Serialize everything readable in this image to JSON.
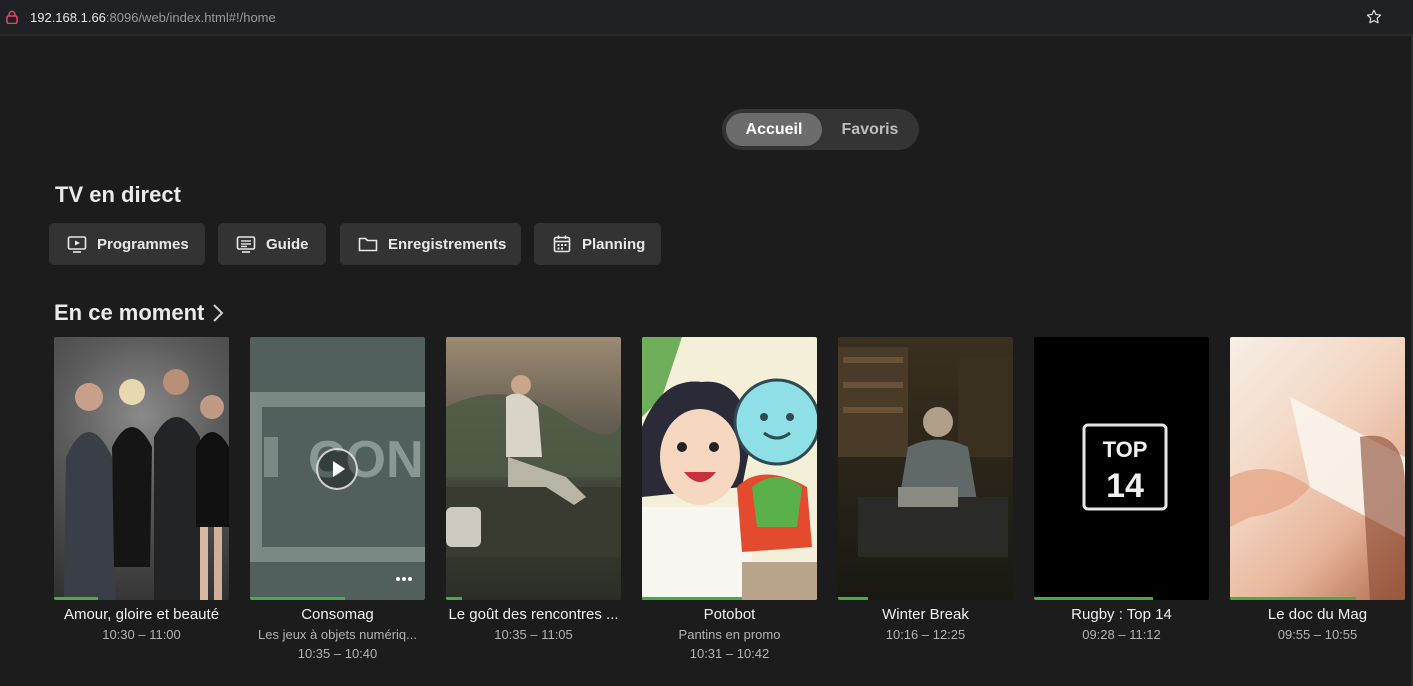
{
  "browser": {
    "url_host": "192.168.1.66",
    "url_path": ":8096/web/index.html#!/home"
  },
  "tabs": [
    {
      "label": "Accueil",
      "active": true
    },
    {
      "label": "Favoris",
      "active": false
    }
  ],
  "live_tv": {
    "title": "TV en direct",
    "buttons": [
      {
        "label": "Programmes",
        "icon": "tv-play-icon"
      },
      {
        "label": "Guide",
        "icon": "guide-icon"
      },
      {
        "label": "Enregistrements",
        "icon": "folder-icon"
      },
      {
        "label": "Planning",
        "icon": "calendar-icon"
      }
    ]
  },
  "now": {
    "title": "En ce moment",
    "items": [
      {
        "title": "Amour, gloire et beauté",
        "subtitle": "",
        "time": "10:30 – 11:00",
        "progress": 0.25
      },
      {
        "title": "Consomag",
        "subtitle": "Les jeux à objets numériq...",
        "time": "10:35 – 10:40",
        "progress": 0.54,
        "thumb_text": "CONSO MAG."
      },
      {
        "title": "Le goût des rencontres ...",
        "subtitle": "",
        "time": "10:35 – 11:05",
        "progress": 0.09
      },
      {
        "title": "Potobot",
        "subtitle": "Pantins en promo",
        "time": "10:31 – 10:42",
        "progress": 0.57
      },
      {
        "title": "Winter Break",
        "subtitle": "",
        "time": "10:16 – 12:25",
        "progress": 0.17
      },
      {
        "title": "Rugby : Top 14",
        "subtitle": "",
        "time": "09:28 – 11:12",
        "progress": 0.68,
        "thumb_text": "TOP 14"
      },
      {
        "title": "Le doc du Mag",
        "subtitle": "",
        "time": "09:55 – 10:55",
        "progress": 0.72
      }
    ]
  },
  "colors": {
    "background": "#1c1c1c",
    "progress": "#3cb43c",
    "button": "#333333"
  }
}
